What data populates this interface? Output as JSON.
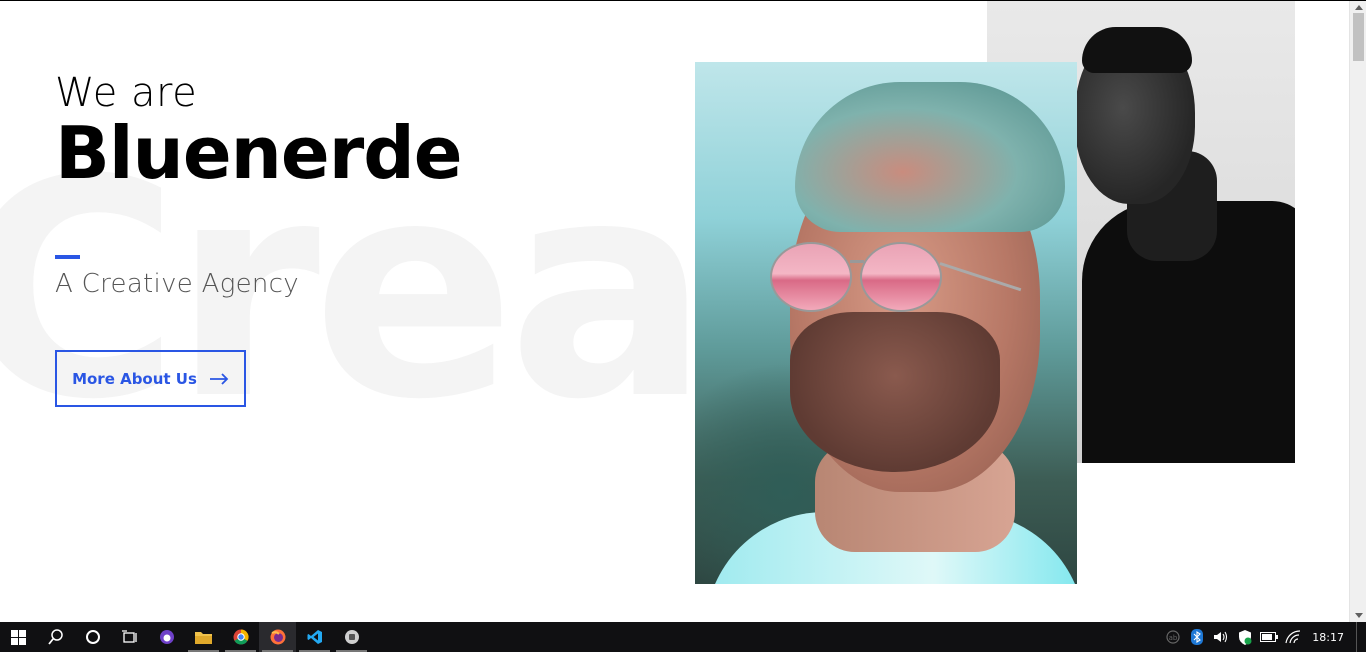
{
  "hero": {
    "pre_title": "We are",
    "title": "Bluenerde",
    "subtitle": "A Creative Agency",
    "background_word": "Creat",
    "cta_label": "More About Us"
  },
  "colors": {
    "accent": "#2a56e4",
    "background": "#ffffff",
    "taskbar": "#101012"
  },
  "taskbar": {
    "apps": [
      "windows-start",
      "search",
      "cortana",
      "task-view",
      "github-desktop",
      "file-explorer",
      "chrome",
      "firefox",
      "vscode",
      "app"
    ],
    "clock": "18:17"
  }
}
